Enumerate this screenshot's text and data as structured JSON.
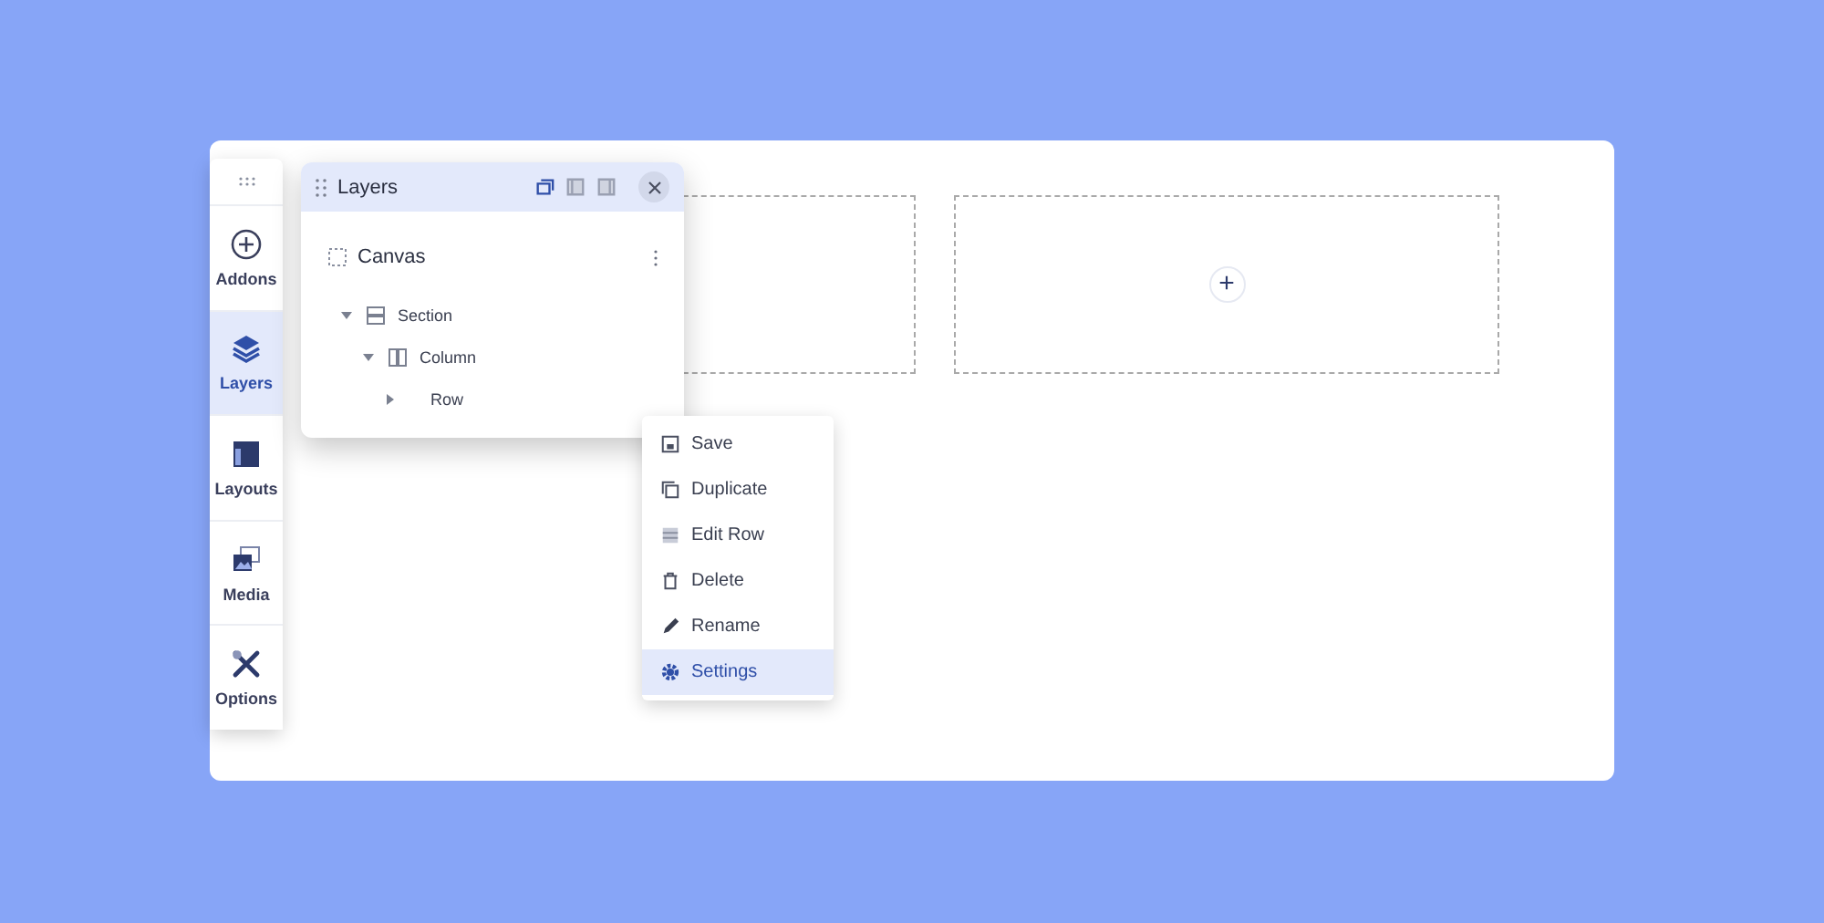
{
  "sidebar": {
    "items": [
      {
        "label": "Addons",
        "selected": false
      },
      {
        "label": "Layers",
        "selected": true
      },
      {
        "label": "Layouts",
        "selected": false
      },
      {
        "label": "Media",
        "selected": false
      },
      {
        "label": "Options",
        "selected": false
      }
    ]
  },
  "layers_panel": {
    "title": "Layers",
    "view_modes": [
      {
        "selected": true
      },
      {
        "selected": false
      },
      {
        "selected": false
      }
    ],
    "tree": {
      "label": "Canvas",
      "children": [
        {
          "label": "Section",
          "expanded": true,
          "children": [
            {
              "label": "Column",
              "expanded": true,
              "children": [
                {
                  "label": "Row",
                  "expanded": false
                }
              ]
            }
          ]
        }
      ]
    }
  },
  "context_menu": {
    "items": [
      {
        "label": "Save",
        "selected": false
      },
      {
        "label": "Duplicate",
        "selected": false
      },
      {
        "label": "Edit Row",
        "selected": false
      },
      {
        "label": "Delete",
        "selected": false
      },
      {
        "label": "Rename",
        "selected": false
      },
      {
        "label": "Settings",
        "selected": true
      }
    ]
  },
  "add_button": {
    "label": "+"
  }
}
